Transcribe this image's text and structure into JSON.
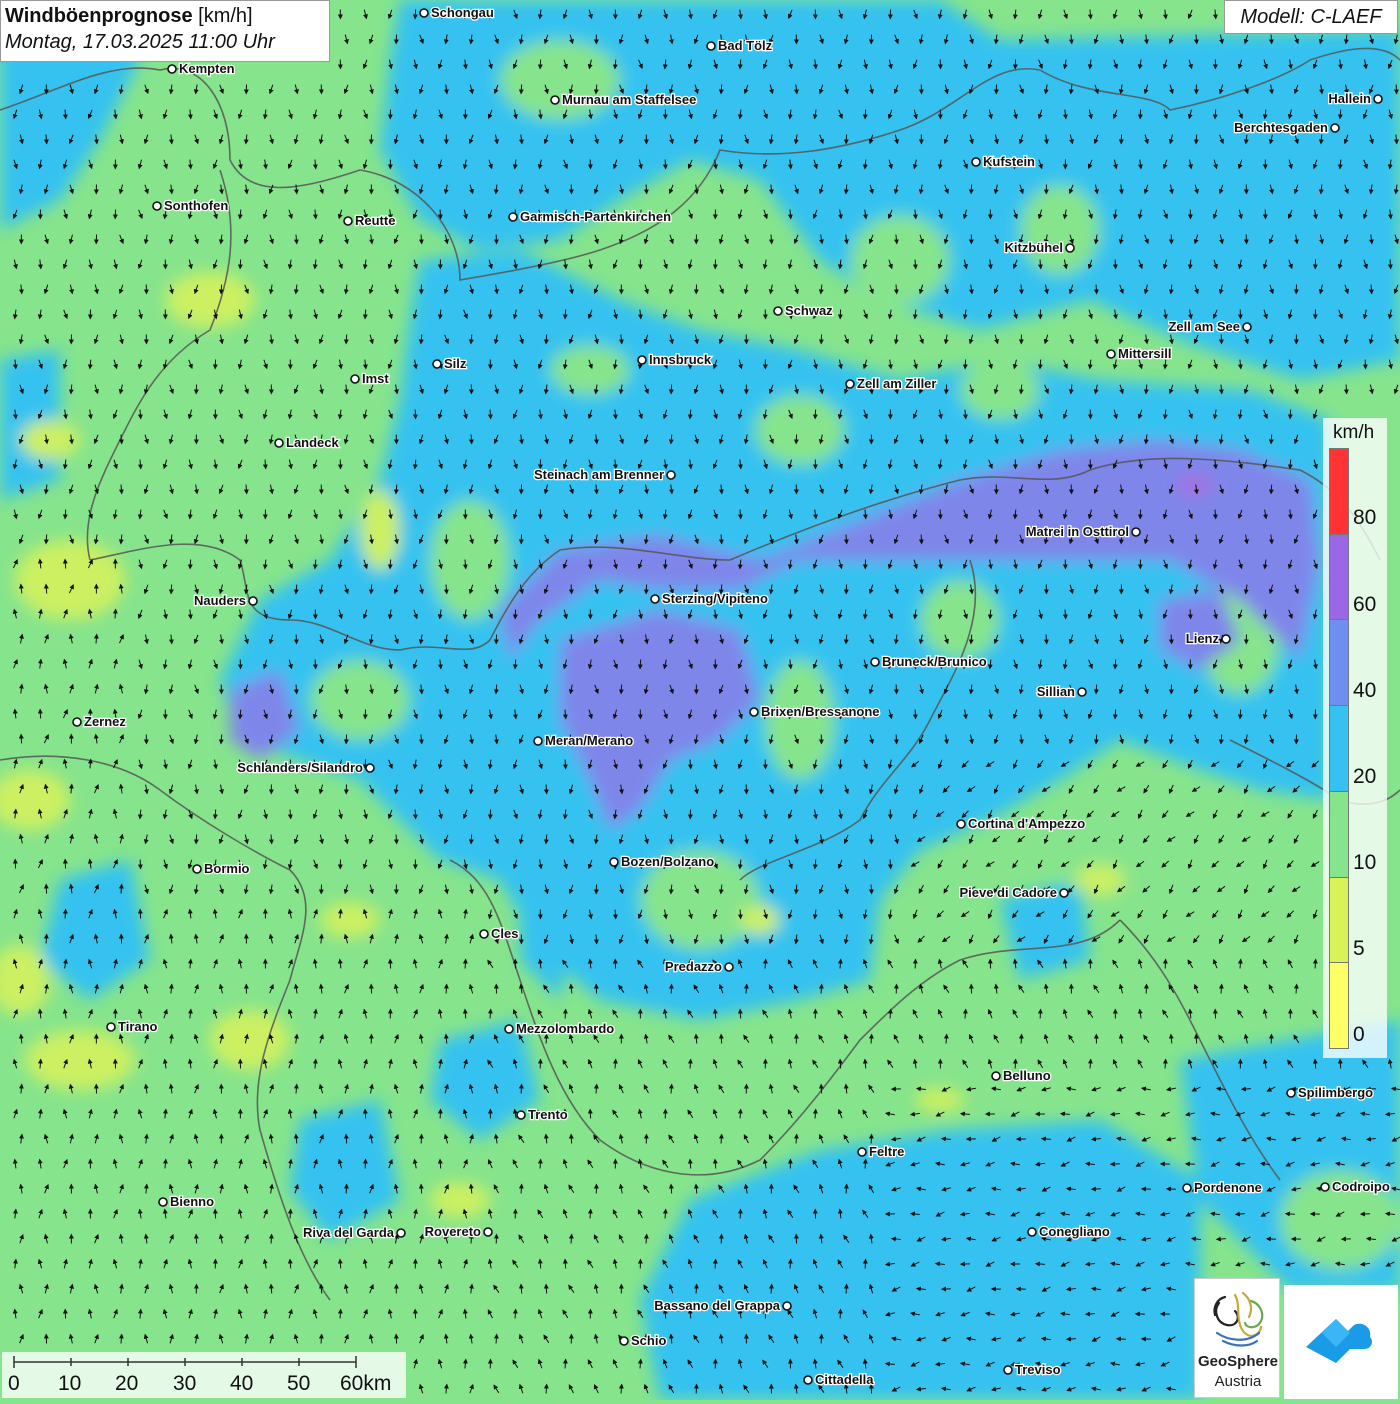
{
  "header": {
    "title": "Windböenprognose",
    "unit": "[km/h]",
    "datetime": "Montag, 17.03.2025 11:00 Uhr",
    "model": "Modell: C-LAEF"
  },
  "legend": {
    "unit": "km/h",
    "ticks": [
      "80",
      "60",
      "40",
      "20",
      "10",
      "5",
      "0"
    ],
    "colors": [
      "#ff3333",
      "#9a68e6",
      "#6f8ff0",
      "#35c2f0",
      "#86e48c",
      "#d8f35a",
      "#ffff66"
    ]
  },
  "scale_bar": {
    "labels": [
      "0",
      "10",
      "20",
      "30",
      "40",
      "50",
      "60km"
    ]
  },
  "logo": {
    "name": "GeoSphere",
    "sub": "Austria",
    "icons": [
      "geosphere-logo-icon",
      "weather-app-icon"
    ]
  },
  "cities": [
    {
      "name": "Schongau"
    },
    {
      "name": "Kempten"
    },
    {
      "name": "Bad Tölz"
    },
    {
      "name": "Murnau am Staffelsee"
    },
    {
      "name": "Hallein"
    },
    {
      "name": "Berchtesgaden"
    },
    {
      "name": "Kufstein"
    },
    {
      "name": "Sonthofen"
    },
    {
      "name": "Reutte"
    },
    {
      "name": "Garmisch-Partenkirchen"
    },
    {
      "name": "Kitzbühel"
    },
    {
      "name": "Schwaz"
    },
    {
      "name": "Zell am See"
    },
    {
      "name": "Mittersill"
    },
    {
      "name": "Silz"
    },
    {
      "name": "Innsbruck"
    },
    {
      "name": "Imst"
    },
    {
      "name": "Zell am Ziller"
    },
    {
      "name": "Landeck"
    },
    {
      "name": "Steinach am Brenner"
    },
    {
      "name": "Matrei in Osttirol"
    },
    {
      "name": "Nauders"
    },
    {
      "name": "Sterzing/Vipiteno"
    },
    {
      "name": "Lienz"
    },
    {
      "name": "Bruneck/Brunico"
    },
    {
      "name": "Sillian"
    },
    {
      "name": "Zernez"
    },
    {
      "name": "Brixen/Bressanone"
    },
    {
      "name": "Meran/Merano"
    },
    {
      "name": "Schlanders/Silandro"
    },
    {
      "name": "Cortina d'Ampezzo"
    },
    {
      "name": "Bozen/Bolzano"
    },
    {
      "name": "Bormio"
    },
    {
      "name": "Pieve di Cadore"
    },
    {
      "name": "Cles"
    },
    {
      "name": "Predazzo"
    },
    {
      "name": "Tirano"
    },
    {
      "name": "Mezzolombardo"
    },
    {
      "name": "Belluno"
    },
    {
      "name": "Spilimbergo"
    },
    {
      "name": "Trento"
    },
    {
      "name": "Feltre"
    },
    {
      "name": "Pordenone"
    },
    {
      "name": "Codroipo"
    },
    {
      "name": "Bienno"
    },
    {
      "name": "Riva del Garda"
    },
    {
      "name": "Rovereto"
    },
    {
      "name": "Conegliano"
    },
    {
      "name": "Bassano del Grappa"
    },
    {
      "name": "Schio"
    },
    {
      "name": "Treviso"
    },
    {
      "name": "Cittadella"
    }
  ]
}
